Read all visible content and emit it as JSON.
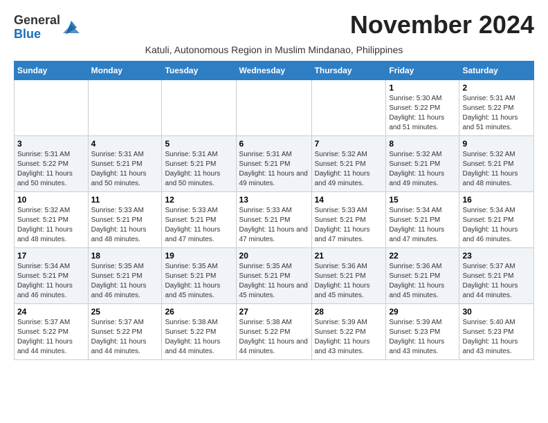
{
  "header": {
    "logo_line1": "General",
    "logo_line2": "Blue",
    "month_title": "November 2024",
    "subtitle": "Katuli, Autonomous Region in Muslim Mindanao, Philippines"
  },
  "days_of_week": [
    "Sunday",
    "Monday",
    "Tuesday",
    "Wednesday",
    "Thursday",
    "Friday",
    "Saturday"
  ],
  "weeks": [
    [
      {
        "day": "",
        "info": ""
      },
      {
        "day": "",
        "info": ""
      },
      {
        "day": "",
        "info": ""
      },
      {
        "day": "",
        "info": ""
      },
      {
        "day": "",
        "info": ""
      },
      {
        "day": "1",
        "info": "Sunrise: 5:30 AM\nSunset: 5:22 PM\nDaylight: 11 hours and 51 minutes."
      },
      {
        "day": "2",
        "info": "Sunrise: 5:31 AM\nSunset: 5:22 PM\nDaylight: 11 hours and 51 minutes."
      }
    ],
    [
      {
        "day": "3",
        "info": "Sunrise: 5:31 AM\nSunset: 5:22 PM\nDaylight: 11 hours and 50 minutes."
      },
      {
        "day": "4",
        "info": "Sunrise: 5:31 AM\nSunset: 5:21 PM\nDaylight: 11 hours and 50 minutes."
      },
      {
        "day": "5",
        "info": "Sunrise: 5:31 AM\nSunset: 5:21 PM\nDaylight: 11 hours and 50 minutes."
      },
      {
        "day": "6",
        "info": "Sunrise: 5:31 AM\nSunset: 5:21 PM\nDaylight: 11 hours and 49 minutes."
      },
      {
        "day": "7",
        "info": "Sunrise: 5:32 AM\nSunset: 5:21 PM\nDaylight: 11 hours and 49 minutes."
      },
      {
        "day": "8",
        "info": "Sunrise: 5:32 AM\nSunset: 5:21 PM\nDaylight: 11 hours and 49 minutes."
      },
      {
        "day": "9",
        "info": "Sunrise: 5:32 AM\nSunset: 5:21 PM\nDaylight: 11 hours and 48 minutes."
      }
    ],
    [
      {
        "day": "10",
        "info": "Sunrise: 5:32 AM\nSunset: 5:21 PM\nDaylight: 11 hours and 48 minutes."
      },
      {
        "day": "11",
        "info": "Sunrise: 5:33 AM\nSunset: 5:21 PM\nDaylight: 11 hours and 48 minutes."
      },
      {
        "day": "12",
        "info": "Sunrise: 5:33 AM\nSunset: 5:21 PM\nDaylight: 11 hours and 47 minutes."
      },
      {
        "day": "13",
        "info": "Sunrise: 5:33 AM\nSunset: 5:21 PM\nDaylight: 11 hours and 47 minutes."
      },
      {
        "day": "14",
        "info": "Sunrise: 5:33 AM\nSunset: 5:21 PM\nDaylight: 11 hours and 47 minutes."
      },
      {
        "day": "15",
        "info": "Sunrise: 5:34 AM\nSunset: 5:21 PM\nDaylight: 11 hours and 47 minutes."
      },
      {
        "day": "16",
        "info": "Sunrise: 5:34 AM\nSunset: 5:21 PM\nDaylight: 11 hours and 46 minutes."
      }
    ],
    [
      {
        "day": "17",
        "info": "Sunrise: 5:34 AM\nSunset: 5:21 PM\nDaylight: 11 hours and 46 minutes."
      },
      {
        "day": "18",
        "info": "Sunrise: 5:35 AM\nSunset: 5:21 PM\nDaylight: 11 hours and 46 minutes."
      },
      {
        "day": "19",
        "info": "Sunrise: 5:35 AM\nSunset: 5:21 PM\nDaylight: 11 hours and 45 minutes."
      },
      {
        "day": "20",
        "info": "Sunrise: 5:35 AM\nSunset: 5:21 PM\nDaylight: 11 hours and 45 minutes."
      },
      {
        "day": "21",
        "info": "Sunrise: 5:36 AM\nSunset: 5:21 PM\nDaylight: 11 hours and 45 minutes."
      },
      {
        "day": "22",
        "info": "Sunrise: 5:36 AM\nSunset: 5:21 PM\nDaylight: 11 hours and 45 minutes."
      },
      {
        "day": "23",
        "info": "Sunrise: 5:37 AM\nSunset: 5:21 PM\nDaylight: 11 hours and 44 minutes."
      }
    ],
    [
      {
        "day": "24",
        "info": "Sunrise: 5:37 AM\nSunset: 5:22 PM\nDaylight: 11 hours and 44 minutes."
      },
      {
        "day": "25",
        "info": "Sunrise: 5:37 AM\nSunset: 5:22 PM\nDaylight: 11 hours and 44 minutes."
      },
      {
        "day": "26",
        "info": "Sunrise: 5:38 AM\nSunset: 5:22 PM\nDaylight: 11 hours and 44 minutes."
      },
      {
        "day": "27",
        "info": "Sunrise: 5:38 AM\nSunset: 5:22 PM\nDaylight: 11 hours and 44 minutes."
      },
      {
        "day": "28",
        "info": "Sunrise: 5:39 AM\nSunset: 5:22 PM\nDaylight: 11 hours and 43 minutes."
      },
      {
        "day": "29",
        "info": "Sunrise: 5:39 AM\nSunset: 5:23 PM\nDaylight: 11 hours and 43 minutes."
      },
      {
        "day": "30",
        "info": "Sunrise: 5:40 AM\nSunset: 5:23 PM\nDaylight: 11 hours and 43 minutes."
      }
    ]
  ]
}
